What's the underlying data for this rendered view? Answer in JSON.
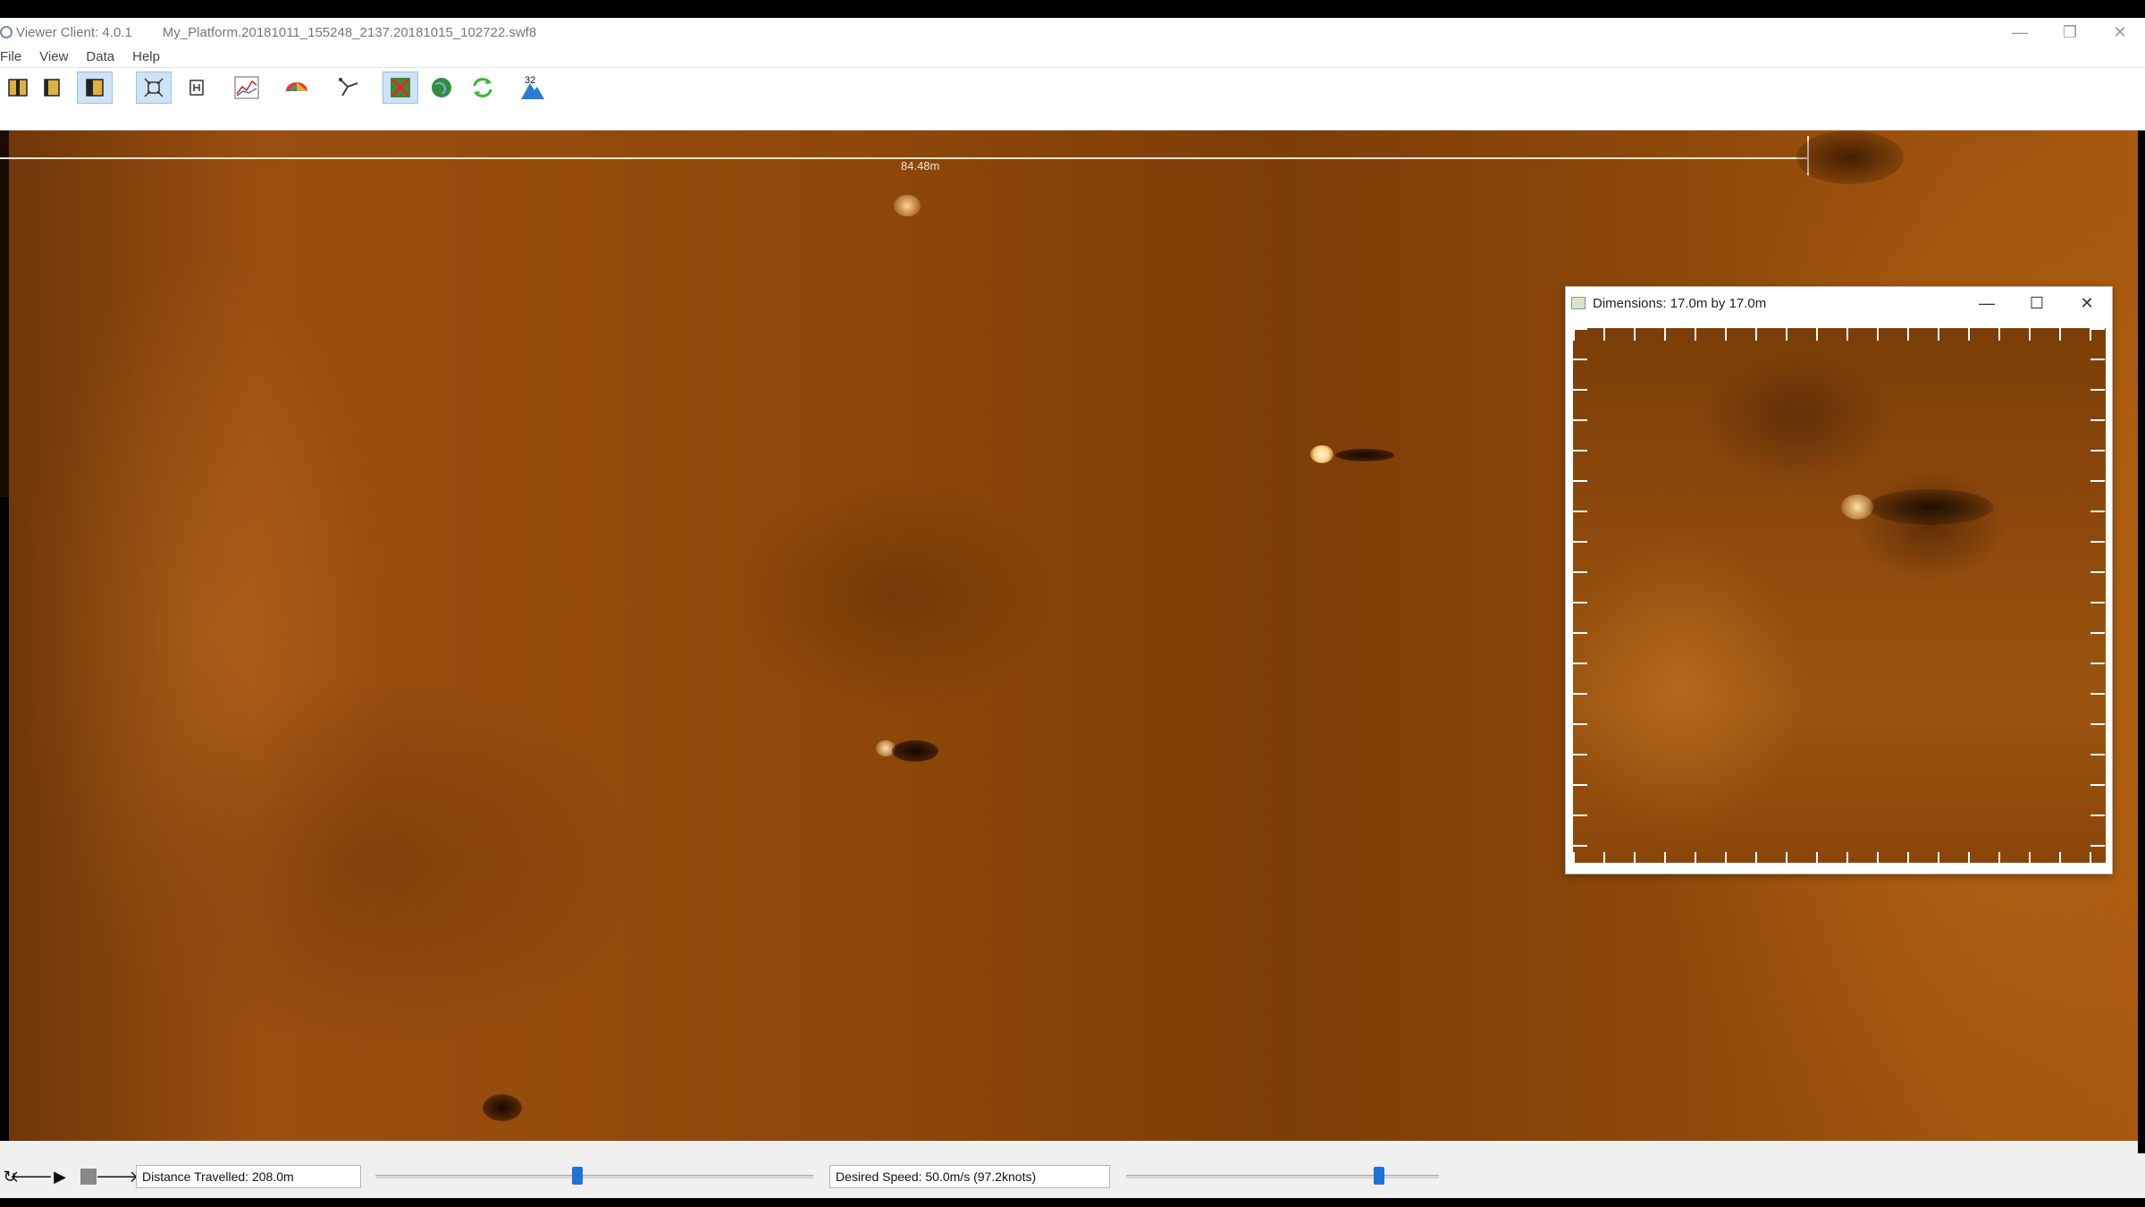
{
  "window": {
    "app_title": "Viewer Client: 4.0.1",
    "file_name": "My_Platform.20181011_155248_2137.20181015_102722.swf8",
    "controls": [
      "minimize-icon",
      "restore-icon",
      "close-icon"
    ]
  },
  "menu": {
    "items": [
      "File",
      "View",
      "Data",
      "Help"
    ]
  },
  "toolbar": {
    "buttons": [
      {
        "icon": "split-view-icon"
      },
      {
        "icon": "port-view-icon"
      },
      {
        "icon": "starboard-view-icon"
      },
      {
        "icon": "fit-view-icon"
      },
      {
        "icon": "measure-box-icon"
      },
      {
        "icon": "line-graph-icon"
      },
      {
        "icon": "color-palette-icon"
      },
      {
        "icon": "track-plot-icon"
      },
      {
        "icon": "target-icon"
      },
      {
        "icon": "globe-icon"
      },
      {
        "icon": "refresh-icon"
      },
      {
        "icon": "depth-icon",
        "badge": "32"
      }
    ]
  },
  "sonar": {
    "scale_label": "84.48m"
  },
  "subwindow": {
    "title": "Dimensions: 17.0m by 17.0m"
  },
  "statusbar": {
    "distance_label": "Distance Travelled: 208.0m",
    "speed_label": "Desired Speed: 50.0m/s (97.2knots)",
    "distance_slider": 0.46,
    "speed_slider": 0.82
  },
  "colors": {
    "sonar_base": "#8e4809",
    "active_button_bg": "#cfe3f7",
    "slider_thumb": "#1e72d8"
  }
}
